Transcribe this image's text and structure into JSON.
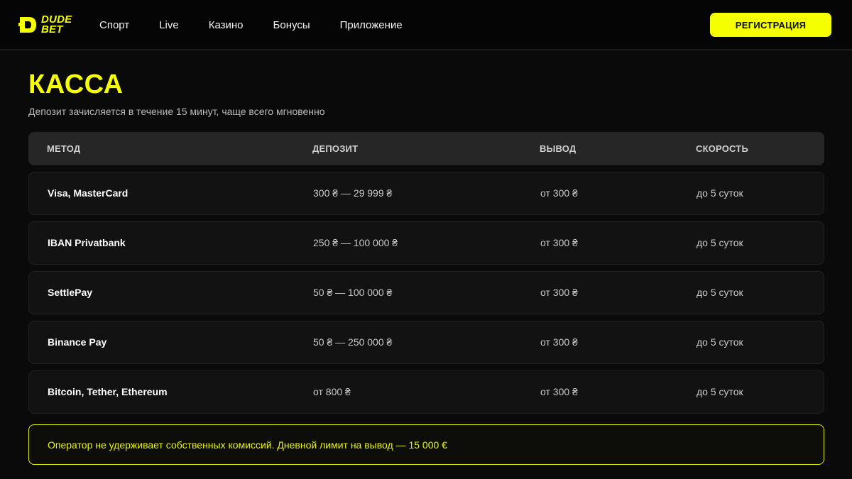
{
  "header": {
    "logo": {
      "line1": "DUDE",
      "line2": "BET"
    },
    "nav": [
      "Спорт",
      "Live",
      "Казино",
      "Бонусы",
      "Приложение"
    ],
    "register_label": "РЕГИСТРАЦИЯ"
  },
  "page": {
    "title": "КАССА",
    "subtitle": "Депозит зачисляется в течение 15 минут, чаще всего мгновенно"
  },
  "table": {
    "columns": [
      "МЕТОД",
      "ДЕПОЗИТ",
      "ВЫВОД",
      "СКОРОСТЬ"
    ],
    "rows": [
      {
        "method": "Visa, MasterCard",
        "deposit": "300 ₴ — 29 999 ₴",
        "withdraw": "от 300 ₴",
        "speed": "до 5 суток"
      },
      {
        "method": "IBAN Privatbank",
        "deposit": "250 ₴ — 100 000 ₴",
        "withdraw": "от 300 ₴",
        "speed": "до 5 суток"
      },
      {
        "method": "SettlePay",
        "deposit": "50 ₴ — 100 000 ₴",
        "withdraw": "от 300 ₴",
        "speed": "до 5 суток"
      },
      {
        "method": "Binance Pay",
        "deposit": "50 ₴ — 250 000 ₴",
        "withdraw": "от 300 ₴",
        "speed": "до 5 суток"
      },
      {
        "method": "Bitcoin, Tether, Ethereum",
        "deposit": "от 800 ₴",
        "withdraw": "от 300 ₴",
        "speed": "до 5 суток"
      }
    ]
  },
  "note": "Оператор не удерживает собственных комиссий. Дневной лимит на вывод — 15 000 €",
  "colors": {
    "accent": "#f5ff00",
    "background": "#0a0a0a",
    "row_bg": "#121212",
    "header_bg": "#262626"
  },
  "icons": {
    "logo": "dudebet-logo-icon"
  }
}
